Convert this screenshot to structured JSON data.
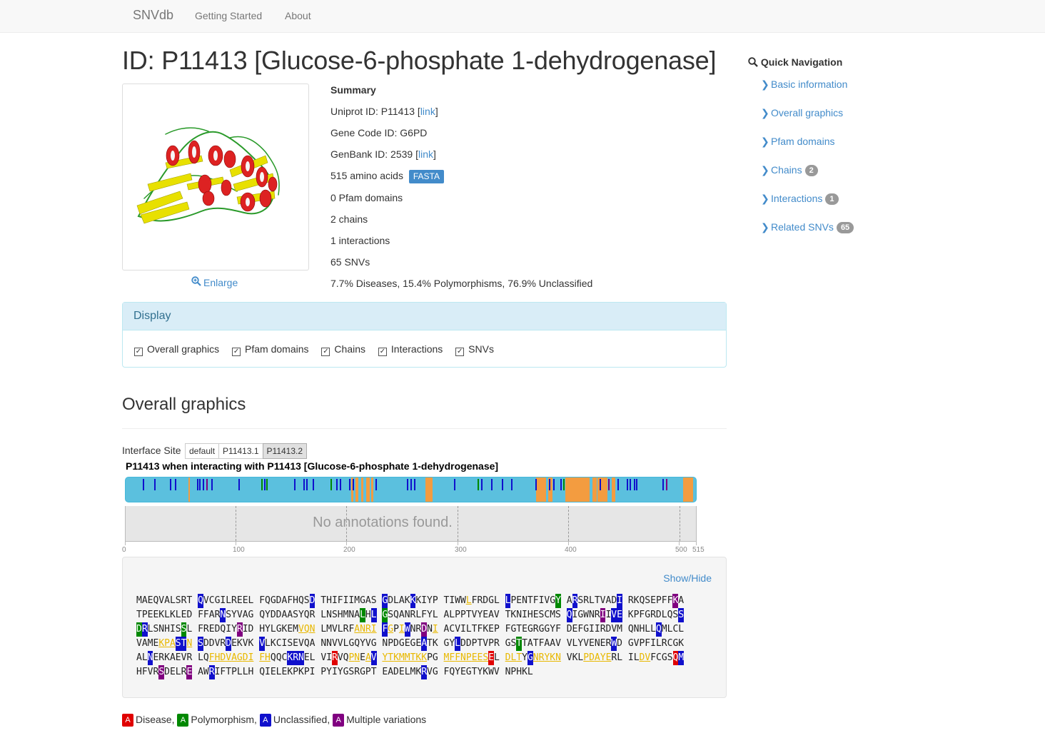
{
  "navbar": {
    "brand": "SNVdb",
    "links": [
      "Getting Started",
      "About"
    ]
  },
  "title": "ID: P11413 [Glucose-6-phosphate 1-dehydrogenase]",
  "enlarge_label": "Enlarge",
  "summary": {
    "heading": "Summary",
    "uniprot_prefix": "Uniprot ID: P11413 [",
    "link_label": "link",
    "suffix": "]",
    "gene_code": "Gene Code ID: G6PD",
    "genbank_prefix": "GenBank ID: 2539 [",
    "amino_acids": "515 amino acids",
    "fasta_label": "FASTA",
    "pfam": "0 Pfam domains",
    "chains": "2 chains",
    "interactions": "1 interactions",
    "snvs": "65 SNVs",
    "distribution": "7.7% Diseases, 15.4% Polymorphisms, 76.9% Unclassified"
  },
  "display_panel": {
    "heading": "Display",
    "options": [
      "Overall graphics",
      "Pfam domains",
      "Chains",
      "Interactions",
      "SNVs"
    ]
  },
  "overall": {
    "section_title": "Overall graphics",
    "interface_label": "Interface Site",
    "interface_buttons": [
      "default",
      "P11413.1",
      "P11413.2"
    ],
    "active_button": "P11413.2",
    "track_title": "P11413 when interacting with P11413 [Glucose-6-phosphate 1-dehydrogenase]",
    "no_annotations": "No annotations found.",
    "axis_ticks": [
      "0",
      "100",
      "200",
      "300",
      "400",
      "500",
      "515"
    ],
    "show_hide": "Show/Hide"
  },
  "sequence_lines": [
    "MAEQVALSRT QVCGILREEL FQGDAFHQSD THIFIIMGAS GDLAKKKIYP TIWWLFRDGL LPENTFIVGY ARSRLTVADI RKQSEPFFKA",
    "TPEEKLKLED FFARNSYVAG QYDDAASYQR LNSHMNALHL GSQANRLFYL ALPPTVYEAV TKNIHESCMS QIGWNRIIVE KPFGRDLQSS",
    "DRLSNHISSL FREDQIYRID HYLGKEMVQN LMVLRFANRI FGPIWNRDNI ACVILTFKEP FGTEGRGGYF DEFGIIRDVM QNHLLQMLCL",
    "VAMEKPASTN SDDVRDEKVK VLKCISEVQA NNVVLGQYVG NPDGEGEATK GYLDDPTVPR GSTTATFAAV VLYVENERWD GVPFILRCGK",
    "ALNERKAEVR LQFHDVAGDI FHQQCKRNEL VIRVQPNEAV YTKMMTKKPG MFFNPEESEL DLTYGNRYKN VKLPDAYERL ILDVFCGSQM",
    "HFVRSDELRE AWRIFTPLLH QIELEKPKPI PYIYGSRGPT EADELMKRVG FQYEGTYKWV NPHKL"
  ],
  "legend": {
    "disease": "Disease,",
    "polymorphism": "Polymorphism,",
    "unclassified": "Unclassified,",
    "multiple": "Multiple variations",
    "letter": "A"
  },
  "quick_nav": {
    "title": "Quick Navigation",
    "items": [
      {
        "label": "Basic information",
        "badge": ""
      },
      {
        "label": "Overall graphics",
        "badge": ""
      },
      {
        "label": "Pfam domains",
        "badge": ""
      },
      {
        "label": "Chains",
        "badge": "2"
      },
      {
        "label": "Interactions",
        "badge": "1"
      },
      {
        "label": "Related SNVs",
        "badge": "65"
      }
    ]
  },
  "colors": {
    "disease": "#e00000",
    "polymorphism": "#008800",
    "unclassified": "#1010cc",
    "multiple": "#800080",
    "interface": "#f39c40",
    "track": "#5bc0de",
    "link": "#428bca"
  }
}
